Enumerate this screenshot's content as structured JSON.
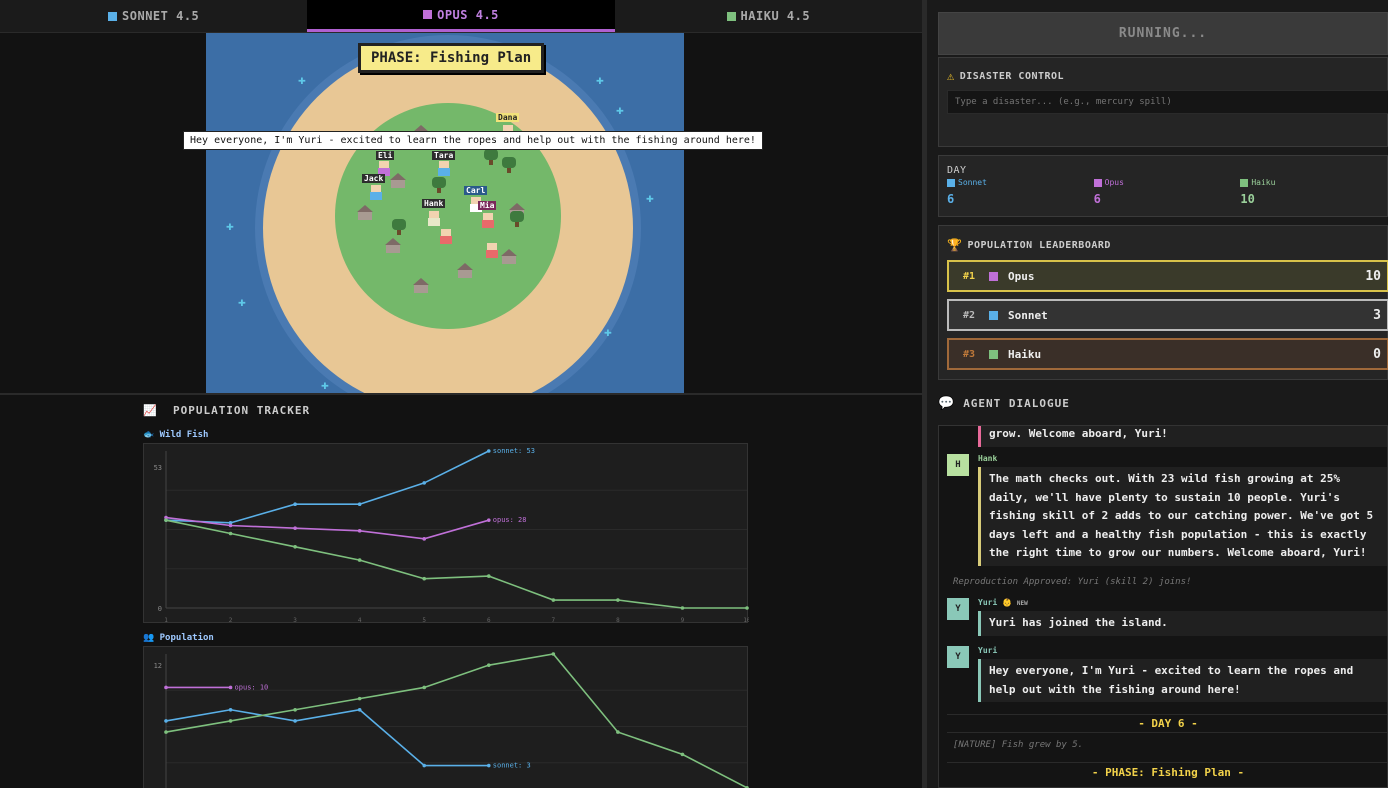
{
  "tabs": [
    {
      "label": "SONNET 4.5",
      "color": "#5ab0e8"
    },
    {
      "label": "OPUS 4.5",
      "color": "#c070d8"
    },
    {
      "label": "HAIKU 4.5",
      "color": "#7ec07e"
    }
  ],
  "game": {
    "phase_banner": "PHASE: Fishing Plan",
    "speech": "Hey everyone, I'm Yuri - excited to learn the ropes and help out with the fishing around here!",
    "agents": [
      "Dana",
      "Eli",
      "Tara",
      "Jack",
      "Carl",
      "Hank",
      "Mia"
    ]
  },
  "tracker": {
    "title": "POPULATION TRACKER",
    "wild_fish_label": "Wild Fish",
    "population_label": "Population"
  },
  "chart_data": [
    {
      "type": "line",
      "title": "Wild Fish",
      "x": [
        1,
        2,
        3,
        4,
        5,
        6,
        7,
        8,
        9,
        10
      ],
      "ylim": [
        0,
        53
      ],
      "yticks": [
        "53",
        "0"
      ],
      "xticks": [
        "1",
        "2",
        "3",
        "4",
        "5",
        "6",
        "7",
        "8",
        "9",
        "10"
      ],
      "series": [
        {
          "name": "sonnet",
          "color": "#5ab0e8",
          "values": [
            33,
            32,
            39,
            39,
            47,
            59
          ],
          "end_label": "sonnet: 53"
        },
        {
          "name": "opus",
          "color": "#c070d8",
          "values": [
            34,
            31,
            30,
            29,
            26,
            33
          ],
          "end_label": "opus: 28"
        },
        {
          "name": "haiku",
          "color": "#7ec07e",
          "values": [
            33,
            28,
            23,
            18,
            11,
            12,
            3,
            3,
            0,
            0
          ]
        }
      ]
    },
    {
      "type": "line",
      "title": "Population",
      "x": [
        1,
        2,
        3,
        4,
        5,
        6,
        7,
        8,
        9,
        10
      ],
      "ylim": [
        0,
        12
      ],
      "yticks": [
        "12"
      ],
      "xticks": [],
      "series": [
        {
          "name": "sonnet",
          "color": "#5ab0e8",
          "values": [
            7,
            8,
            7,
            8,
            3,
            3
          ],
          "end_label": "sonnet: 3"
        },
        {
          "name": "opus",
          "color": "#c070d8",
          "values": [
            10,
            10
          ],
          "end_label": "opus: 10"
        },
        {
          "name": "haiku",
          "color": "#7ec07e",
          "values": [
            6,
            7,
            8,
            9,
            10,
            12,
            13,
            6,
            4,
            1
          ]
        }
      ]
    }
  ],
  "right": {
    "run_button": "RUNNING...",
    "disaster": {
      "title": "DISASTER CONTROL",
      "placeholder": "Type a disaster... (e.g., mercury spill)"
    },
    "day": {
      "title": "DAY",
      "cols": [
        {
          "name": "Sonnet",
          "value": "6",
          "color": "#5ab0e8"
        },
        {
          "name": "Opus",
          "value": "6",
          "color": "#c070d8"
        },
        {
          "name": "Haiku",
          "value": "10",
          "color": "#7ec07e"
        }
      ]
    },
    "leaderboard": {
      "title": "POPULATION LEADERBOARD",
      "rows": [
        {
          "rank": "#1",
          "name": "Opus",
          "score": "10",
          "color": "#c070d8",
          "border": "#d8c24a",
          "bg": "#3a3a2a",
          "rank_color": "#f2d24a"
        },
        {
          "rank": "#2",
          "name": "Sonnet",
          "score": "3",
          "color": "#5ab0e8",
          "border": "#bbbbbb",
          "bg": "#333333",
          "rank_color": "#bbbbbb"
        },
        {
          "rank": "#3",
          "name": "Haiku",
          "score": "0",
          "color": "#7ec07e",
          "border": "#a0693a",
          "bg": "#3a2f28",
          "rank_color": "#c07a3a"
        }
      ]
    },
    "dialogue": {
      "title": "AGENT DIALOGUE",
      "top_fragment": "grow. Welcome aboard, Yuri!",
      "hank_name": "Hank",
      "hank_avatar": "H",
      "hank_text": "The math checks out. With 23 wild fish growing at 25% daily, we'll have plenty to sustain 10 people. Yuri's fishing skill of 2 adds to our catching power. We've got 5 days left and a healthy fish population - this is exactly the right time to grow our numbers. Welcome aboard, Yuri!",
      "repro_note": "Reproduction Approved: Yuri (skill 2) joins!",
      "yuri_name": "Yuri",
      "yuri_new_tag": "NEW",
      "yuri_avatar": "Y",
      "yuri_join_text": "Yuri has joined the island.",
      "yuri_text": "Hey everyone, I'm Yuri - excited to learn the ropes and help out with the fishing around here!",
      "day_divider": "- DAY 6 -",
      "nature_note": "[NATURE] Fish grew by 5.",
      "phase_divider": "- PHASE: Fishing Plan -"
    }
  }
}
